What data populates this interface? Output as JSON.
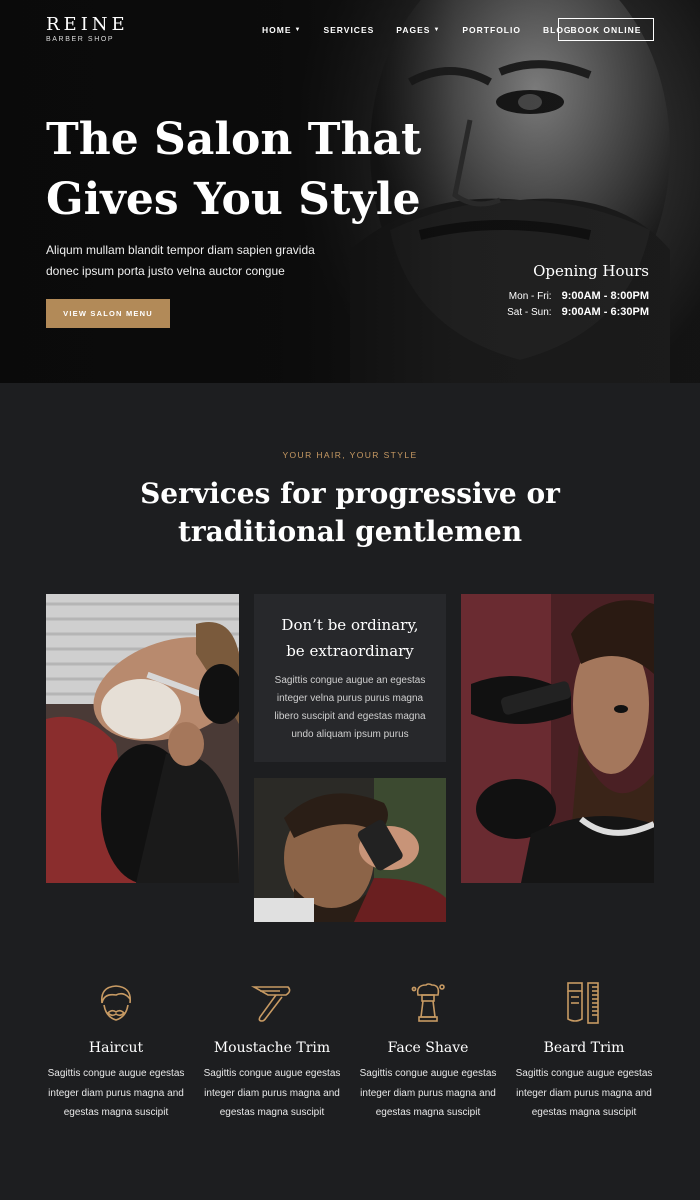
{
  "brand": {
    "name": "REINE",
    "tagline": "BARBER SHOP"
  },
  "nav": {
    "items": [
      {
        "label": "HOME",
        "has_dropdown": true
      },
      {
        "label": "SERVICES",
        "has_dropdown": false
      },
      {
        "label": "PAGES",
        "has_dropdown": true
      },
      {
        "label": "PORTFOLIO",
        "has_dropdown": false
      },
      {
        "label": "BLOG",
        "has_dropdown": false
      }
    ],
    "cta": "BOOK ONLINE"
  },
  "hero": {
    "title_line1": "The Salon That",
    "title_line2": "Gives You Style",
    "description": "Aliqum mullam blandit tempor diam sapien gravida donec ipsum porta justo velna auctor congue",
    "button": "VIEW SALON MENU",
    "hours": {
      "title": "Opening Hours",
      "rows": [
        {
          "day": "Mon - Fri:",
          "time": "9:00AM - 8:00PM"
        },
        {
          "day": "Sat - Sun:",
          "time": "9:00AM - 6:30PM"
        }
      ]
    }
  },
  "section": {
    "eyebrow": "YOUR HAIR, YOUR STYLE",
    "title_line1": "Services for progressive or",
    "title_line2": "traditional gentlemen",
    "card": {
      "title_line1": "Don’t be ordinary,",
      "title_line2": "be extraordinary",
      "description": "Sagittis congue augue an egestas integer velna purus purus magna libero suscipit and egestas magna undo aliquam ipsum purus"
    }
  },
  "services": [
    {
      "icon": "haircut-icon",
      "title": "Haircut",
      "description": "Sagittis congue augue egestas integer diam purus magna and egestas magna suscipit"
    },
    {
      "icon": "razor-icon",
      "title": "Moustache Trim",
      "description": "Sagittis congue augue egestas integer diam purus magna and egestas magna suscipit"
    },
    {
      "icon": "shaving-brush-icon",
      "title": "Face Shave",
      "description": "Sagittis congue augue egestas integer diam purus magna and egestas magna suscipit"
    },
    {
      "icon": "trimmer-comb-icon",
      "title": "Beard Trim",
      "description": "Sagittis congue augue egestas integer diam purus magna and egestas magna suscipit"
    }
  ],
  "colors": {
    "accent": "#b28a58",
    "eyebrow": "#c79a63",
    "background": "#1d1e20",
    "card": "#27282b"
  }
}
